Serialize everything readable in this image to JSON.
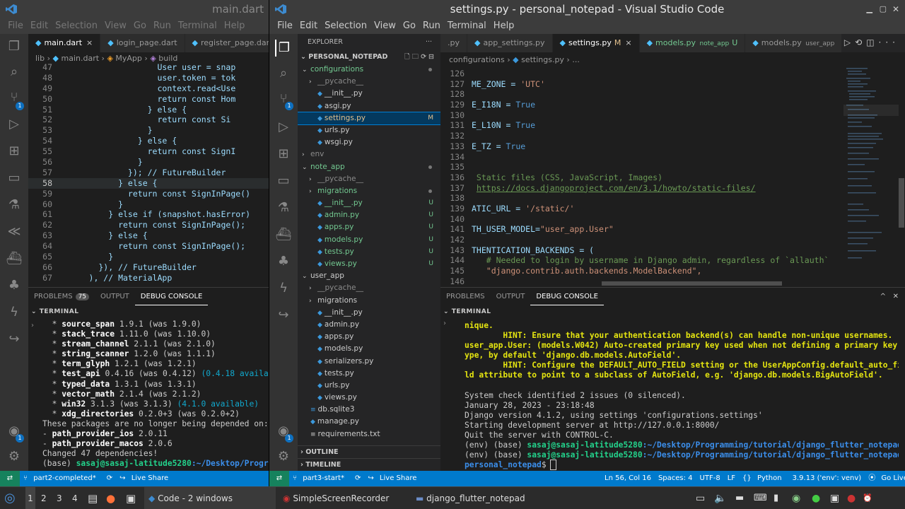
{
  "left_window": {
    "title": "main.dart",
    "menu": [
      "File",
      "Edit",
      "Selection",
      "View",
      "Go",
      "Run",
      "Terminal",
      "Help"
    ],
    "tabs": [
      {
        "label": "main.dart",
        "active": true,
        "close": "×"
      },
      {
        "label": "login_page.dart"
      },
      {
        "label": "register_page.dart"
      }
    ],
    "breadcrumb": [
      "lib",
      "main.dart",
      "MyApp",
      "build"
    ],
    "code": [
      {
        "n": "47",
        "t": "                    User user = snap"
      },
      {
        "n": "48",
        "t": "                    user.token = tok"
      },
      {
        "n": "49",
        "t": "                    context.read<Use"
      },
      {
        "n": "50",
        "t": "                    return const Hom"
      },
      {
        "n": "51",
        "t": "                  } else {"
      },
      {
        "n": "52",
        "t": "                    return const Si"
      },
      {
        "n": "53",
        "t": "                  }"
      },
      {
        "n": "54",
        "t": "                } else {"
      },
      {
        "n": "55",
        "t": "                  return const SignI"
      },
      {
        "n": "56",
        "t": "                }"
      },
      {
        "n": "57",
        "t": "              }); // FutureBuilder"
      },
      {
        "n": "58",
        "t": "            } else {"
      },
      {
        "n": "59",
        "t": "              return const SignInPage()"
      },
      {
        "n": "60",
        "t": "            }"
      },
      {
        "n": "61",
        "t": "          } else if (snapshot.hasError)"
      },
      {
        "n": "62",
        "t": "            return const SignInPage();"
      },
      {
        "n": "63",
        "t": "          } else {"
      },
      {
        "n": "64",
        "t": "            return const SignInPage();"
      },
      {
        "n": "65",
        "t": "          }"
      },
      {
        "n": "66",
        "t": "        }), // FutureBuilder"
      },
      {
        "n": "67",
        "t": "      ), // MaterialApp"
      }
    ],
    "panel_tabs": {
      "problems": "PROBLEMS",
      "problems_count": "75",
      "output": "OUTPUT",
      "debug": "DEBUG CONSOLE"
    },
    "terminal_label": "TERMINAL",
    "terminal": [
      {
        "a": "  * ",
        "b": "source_span",
        "c": " 1.9.1 (was 1.9.0)"
      },
      {
        "a": "  * ",
        "b": "stack_trace",
        "c": " 1.11.0 (was 1.10.0)"
      },
      {
        "a": "  * ",
        "b": "stream_channel",
        "c": " 2.1.1 (was 2.1.0)"
      },
      {
        "a": "  * ",
        "b": "string_scanner",
        "c": " 1.2.0 (was 1.1.1)"
      },
      {
        "a": "  * ",
        "b": "term_glyph",
        "c": " 1.2.1 (was 1.2.1)"
      },
      {
        "a": "  * ",
        "b": "test_api",
        "c": " 0.4.16 (was 0.4.12) ",
        "d": "(0.4.18 available)"
      },
      {
        "a": "  * ",
        "b": "typed_data",
        "c": " 1.3.1 (was 1.3.1)"
      },
      {
        "a": "  * ",
        "b": "vector_math",
        "c": " 2.1.4 (was 2.1.2)"
      },
      {
        "a": "  * ",
        "b": "win32",
        "c": " 3.1.3 (was 3.1.3) ",
        "d": "(4.1.0 available)"
      },
      {
        "a": "  * ",
        "b": "xdg_directories",
        "c": " 0.2.0+3 (was 0.2.0+2)"
      },
      {
        "a": "",
        "b": "",
        "c": "These packages are no longer being depended on:"
      },
      {
        "a": "",
        "b": "",
        "c": "- ",
        "e": "path_provider_ios",
        "f": " 2.0.11"
      },
      {
        "a": "",
        "b": "",
        "c": "- ",
        "e": "path_provider_macos",
        "f": " 2.0.6"
      },
      {
        "a": "",
        "b": "",
        "c": "Changed 47 dependencies!"
      },
      {
        "a": "",
        "b": "",
        "c": "(base) ",
        "g": "sasaj@sasaj-latitude5280",
        "h": ":~/Desktop/Progr"
      }
    ],
    "status": {
      "branch": "part2-completed*",
      "sync": "⟳",
      "live_share": "Live Share"
    }
  },
  "right_window": {
    "title": "settings.py - personal_notepad - Visual Studio Code",
    "menu": [
      "File",
      "Edit",
      "Selection",
      "View",
      "Go",
      "Run",
      "Terminal",
      "Help"
    ],
    "explorer": {
      "header": "EXPLORER",
      "project": "PERSONAL_NOTEPAD",
      "rows": [
        {
          "d": 0,
          "chev": "⌄",
          "label": "configurations",
          "dot": true
        },
        {
          "d": 1,
          "chev": "›",
          "label": "__pycache__",
          "dim": true
        },
        {
          "d": 1,
          "py": true,
          "label": "__init__.py"
        },
        {
          "d": 1,
          "py": true,
          "label": "asgi.py"
        },
        {
          "d": 1,
          "py": true,
          "label": "settings.py",
          "mark": "M",
          "sel": true
        },
        {
          "d": 1,
          "py": true,
          "label": "urls.py"
        },
        {
          "d": 1,
          "py": true,
          "label": "wsgi.py"
        },
        {
          "d": 0,
          "chev": "›",
          "label": "env",
          "dim": true
        },
        {
          "d": 0,
          "chev": "⌄",
          "label": "note_app",
          "dot": true
        },
        {
          "d": 1,
          "chev": "›",
          "label": "__pycache__",
          "dim": true
        },
        {
          "d": 1,
          "chev": "›",
          "label": "migrations",
          "dot": true
        },
        {
          "d": 1,
          "py": true,
          "label": "__init__.py",
          "mark": "U"
        },
        {
          "d": 1,
          "py": true,
          "label": "admin.py",
          "mark": "U"
        },
        {
          "d": 1,
          "py": true,
          "label": "apps.py",
          "mark": "U"
        },
        {
          "d": 1,
          "py": true,
          "label": "models.py",
          "mark": "U"
        },
        {
          "d": 1,
          "py": true,
          "label": "tests.py",
          "mark": "U"
        },
        {
          "d": 1,
          "py": true,
          "label": "views.py",
          "mark": "U"
        },
        {
          "d": 0,
          "chev": "⌄",
          "label": "user_app"
        },
        {
          "d": 1,
          "chev": "›",
          "label": "__pycache__",
          "dim": true
        },
        {
          "d": 1,
          "chev": "›",
          "label": "migrations"
        },
        {
          "d": 1,
          "py": true,
          "label": "__init__.py"
        },
        {
          "d": 1,
          "py": true,
          "label": "admin.py"
        },
        {
          "d": 1,
          "py": true,
          "label": "apps.py"
        },
        {
          "d": 1,
          "py": true,
          "label": "models.py"
        },
        {
          "d": 1,
          "py": true,
          "label": "serializers.py"
        },
        {
          "d": 1,
          "py": true,
          "label": "tests.py"
        },
        {
          "d": 1,
          "py": true,
          "label": "urls.py"
        },
        {
          "d": 1,
          "py": true,
          "label": "views.py"
        },
        {
          "d": 0,
          "db": true,
          "label": "db.sqlite3"
        },
        {
          "d": 0,
          "py": true,
          "label": "manage.py"
        },
        {
          "d": 0,
          "txt": true,
          "label": "requirements.txt"
        }
      ],
      "outline": "OUTLINE",
      "timeline": "TIMELINE"
    },
    "tabs": [
      {
        "label": ".py"
      },
      {
        "label": "app_settings.py"
      },
      {
        "label": "settings.py",
        "active": true,
        "tagm": "M",
        "close": "×"
      },
      {
        "label": "models.py",
        "tag": "note_app",
        "tagm": "U"
      },
      {
        "label": "models.py",
        "tag": "user_app"
      }
    ],
    "breadcrumb": [
      "configurations",
      "settings.py",
      "..."
    ],
    "code": [
      {
        "n": "126",
        "t": ""
      },
      {
        "n": "127",
        "t": "ME_ZONE = ",
        "s": "'UTC'"
      },
      {
        "n": "128",
        "t": ""
      },
      {
        "n": "129",
        "t": "E_I18N = ",
        "k": "True"
      },
      {
        "n": "130",
        "t": ""
      },
      {
        "n": "131",
        "t": "E_L10N = ",
        "k": "True"
      },
      {
        "n": "132",
        "t": ""
      },
      {
        "n": "133",
        "t": "E_TZ = ",
        "k": "True"
      },
      {
        "n": "134",
        "t": ""
      },
      {
        "n": "135",
        "t": ""
      },
      {
        "n": "136",
        "c": " Static files (CSS, JavaScript, Images)"
      },
      {
        "n": "137",
        "c": " ",
        "u": "https://docs.djangoproject.com/en/3.1/howto/static-files/"
      },
      {
        "n": "138",
        "t": ""
      },
      {
        "n": "139",
        "t": "ATIC_URL = ",
        "s": "'/static/'"
      },
      {
        "n": "140",
        "t": ""
      },
      {
        "n": "141",
        "t": "TH_USER_MODEL=",
        "s": "\"user_app.User\""
      },
      {
        "n": "142",
        "t": ""
      },
      {
        "n": "143",
        "t": "THENTICATION_BACKENDS = ("
      },
      {
        "n": "144",
        "c": "   # Needed to login by username in Django admin, regardless of `allauth`"
      },
      {
        "n": "145",
        "s2": "   \"django.contrib.auth.backends.ModelBackend\",",
        "t2": ""
      },
      {
        "n": "146",
        "t": ""
      }
    ],
    "panel_tabs": {
      "problems": "PROBLEMS",
      "output": "OUTPUT",
      "debug": "DEBUG CONSOLE"
    },
    "terminal_label": "TERMINAL",
    "terminal": [
      {
        "y": "nique."
      },
      {
        "y": "        HINT: Ensure that your authentication backend(s) can handle non-unique usernames."
      },
      {
        "y": "user_app.User: (models.W042) Auto-created primary key used when not defining a primary key t"
      },
      {
        "y": "ype, by default 'django.db.models.AutoField'."
      },
      {
        "y": "        HINT: Configure the DEFAULT_AUTO_FIELD setting or the UserAppConfig.default_auto_fie"
      },
      {
        "y": "ld attribute to point to a subclass of AutoField, e.g. 'django.db.models.BigAutoField'."
      },
      {
        "w": ""
      },
      {
        "w": "System check identified 2 issues (0 silenced)."
      },
      {
        "w": "January 28, 2023 - 23:18:48"
      },
      {
        "w": "Django version 4.1.2, using settings 'configurations.settings'"
      },
      {
        "w": "Starting development server at http://127.0.0.1:8000/"
      },
      {
        "w": "Quit the server with CONTROL-C."
      },
      {
        "w": "(env) (base) ",
        "g": "sasaj@sasaj-latitude5280",
        "h": ":~/Desktop/Programming/tutorial/django_flutter_notepad/"
      },
      {
        "w": "(env) (base) ",
        "g": "sasaj@sasaj-latitude5280",
        "h": ":~/Desktop/Programming/tutorial/django_flutter_notepad/"
      },
      {
        "p": "personal_notepad",
        "w": "$ "
      }
    ],
    "status": {
      "branch": "part3-start*",
      "live_share": "Live Share",
      "position": "Ln 56, Col 16",
      "spaces": "Spaces: 4",
      "encoding": "UTF-8",
      "eol": "LF",
      "language": "Python",
      "interpreter": "3.9.13 ('env': venv)",
      "golive": "Go Live"
    }
  },
  "taskbar": {
    "workspaces": [
      "1",
      "2",
      "3",
      "4"
    ],
    "items": [
      {
        "label": "Code - 2 windows"
      },
      {
        "label": "SimpleScreenRecorder"
      },
      {
        "label": "django_flutter_notepad"
      }
    ]
  }
}
